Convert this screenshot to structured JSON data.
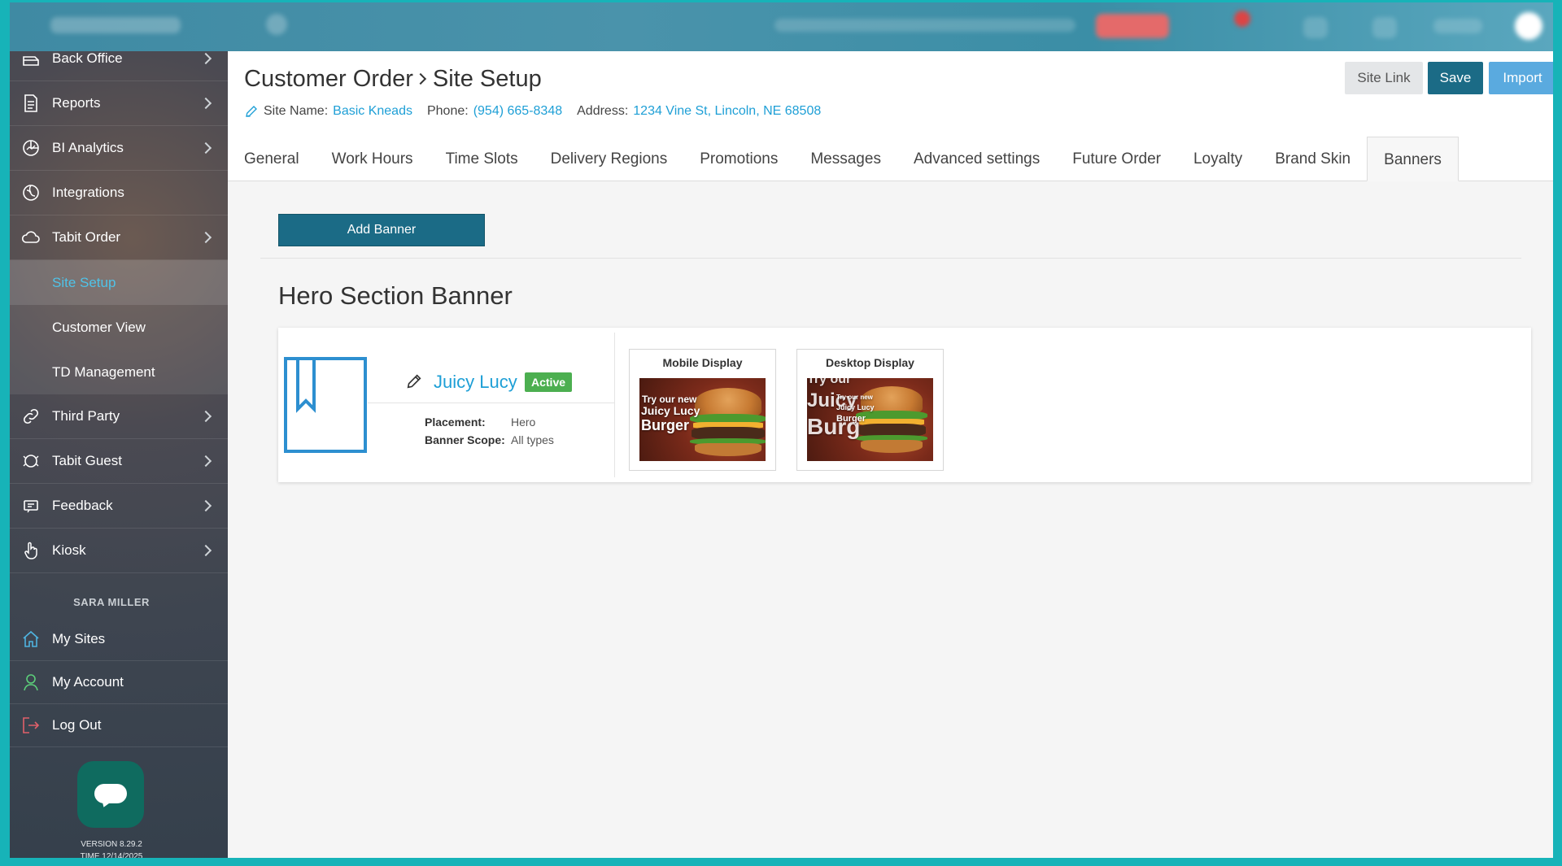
{
  "sidebar": {
    "items": [
      {
        "label": "Back Office",
        "icon": "back-office-icon",
        "chevron": true
      },
      {
        "label": "Reports",
        "icon": "document-icon",
        "chevron": true
      },
      {
        "label": "BI Analytics",
        "icon": "pie-chart-icon",
        "chevron": true
      },
      {
        "label": "Integrations",
        "icon": "integrations-icon",
        "chevron": false
      },
      {
        "label": "Tabit Order",
        "icon": "cloud-icon",
        "chevron": true
      },
      {
        "label": "Site Setup",
        "sub": true,
        "active": true
      },
      {
        "label": "Customer View",
        "sub": true
      },
      {
        "label": "TD Management",
        "sub": true
      },
      {
        "label": "Third Party",
        "icon": "link-icon",
        "chevron": true
      },
      {
        "label": "Tabit Guest",
        "icon": "guest-icon",
        "chevron": true
      },
      {
        "label": "Feedback",
        "icon": "feedback-icon",
        "chevron": true
      },
      {
        "label": "Kiosk",
        "icon": "hand-pointer-icon",
        "chevron": true
      }
    ],
    "user_name": "SARA MILLER",
    "account_items": [
      {
        "label": "My Sites",
        "icon": "home-icon"
      },
      {
        "label": "My Account",
        "icon": "user-icon"
      },
      {
        "label": "Log Out",
        "icon": "logout-icon"
      }
    ],
    "version": "VERSION 8.29.2",
    "time": "TIME 12/14/2025"
  },
  "header": {
    "breadcrumb_parent": "Customer Order",
    "breadcrumb_current": "Site Setup",
    "site_name_label": "Site Name:",
    "site_name": "Basic Kneads",
    "phone_label": "Phone:",
    "phone": "(954) 665-8348",
    "address_label": "Address:",
    "address": "1234 Vine St, Lincoln, NE 68508",
    "site_link_label": "Site Link",
    "save_label": "Save",
    "import_label": "Import"
  },
  "tabs": [
    {
      "label": "General"
    },
    {
      "label": "Work Hours"
    },
    {
      "label": "Time Slots"
    },
    {
      "label": "Delivery Regions"
    },
    {
      "label": "Promotions"
    },
    {
      "label": "Messages"
    },
    {
      "label": "Advanced settings"
    },
    {
      "label": "Future Order"
    },
    {
      "label": "Loyalty"
    },
    {
      "label": "Brand Skin"
    },
    {
      "label": "Banners",
      "active": true
    }
  ],
  "banners_page": {
    "add_banner_label": "Add Banner",
    "section_title": "Hero Section Banner",
    "banner": {
      "name": "Juicy Lucy",
      "status": "Active",
      "placement_label": "Placement:",
      "placement": "Hero",
      "scope_label": "Banner Scope:",
      "scope": "All types",
      "mobile_label": "Mobile Display",
      "desktop_label": "Desktop Display",
      "mobile_text": [
        "Try our new",
        "Juicy Lucy",
        "Burger"
      ],
      "desktop_text_big": [
        "Try our",
        "Juicy",
        "Burg"
      ],
      "desktop_text_small": [
        "Try our new",
        "Juicy Lucy",
        "Burger"
      ]
    }
  },
  "colors": {
    "accent": "#1b6b86",
    "link": "#1e9fd6",
    "import": "#5aaadf",
    "active_badge": "#4caf50",
    "frame": "#17b3b8"
  }
}
